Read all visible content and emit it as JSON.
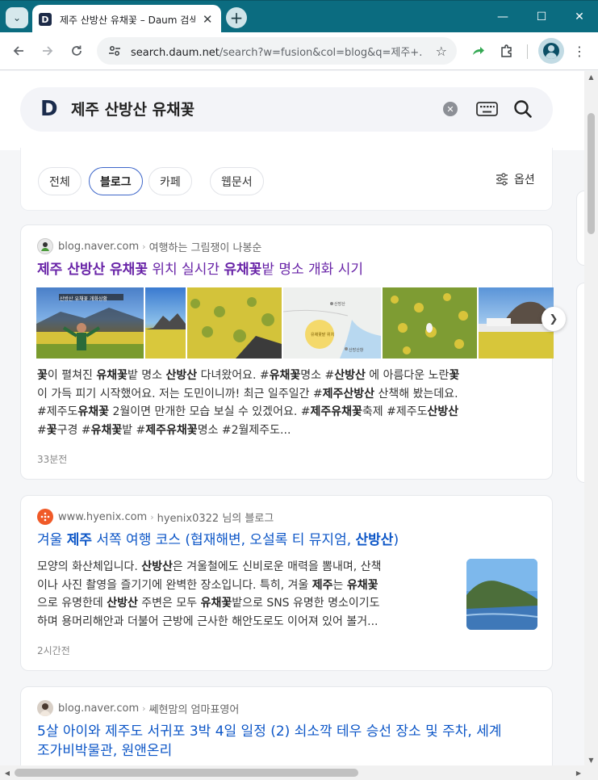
{
  "browser": {
    "tab_title": "제주 산방산 유채꽃 – Daum 검색",
    "favicon_letter": "D",
    "url_host": "search.daum.net",
    "url_rest": "/search?w=fusion&col=blog&q=제주+...",
    "icons": [
      "tab-list-icon",
      "close-icon",
      "new-tab-icon",
      "minimize-icon",
      "maximize-icon",
      "close-window-icon",
      "back-icon",
      "forward-icon",
      "reload-icon",
      "site-settings-icon",
      "bookmark-star-icon",
      "share-icon",
      "extensions-icon",
      "profile-icon",
      "more-menu-icon"
    ]
  },
  "search": {
    "logo": "D",
    "query": "제주 산방산 유채꽃"
  },
  "filters": {
    "chips": [
      "전체",
      "블로그",
      "카페",
      "웹문서"
    ],
    "active": "블로그",
    "options_label": "옵션"
  },
  "results": [
    {
      "source_host": "blog.naver.com",
      "source_author": "여행하는 그림쟁이 나봉순",
      "title_parts": [
        {
          "t": "제주 산방산 유채꽃",
          "b": true
        },
        {
          "t": " 위치 실시간 ",
          "b": false
        },
        {
          "t": "유채꽃",
          "b": true
        },
        {
          "t": "밭 명소 개화 시기",
          "b": false
        }
      ],
      "thumb_labels": [
        "산방산 유채꽃 개화상황",
        "유채꽃밭 위치",
        "산방산",
        "산방산항"
      ],
      "snippet_lines": [
        [
          {
            "t": "꽃",
            "b": true
          },
          {
            "t": "이 펼쳐진 ",
            "b": false
          },
          {
            "t": "유채꽃",
            "b": true
          },
          {
            "t": "밭 명소 ",
            "b": false
          },
          {
            "t": "산방산",
            "b": true
          },
          {
            "t": " 다녀왔어요.  #",
            "b": false
          },
          {
            "t": "유채꽃",
            "b": true
          },
          {
            "t": "명소 #",
            "b": false
          },
          {
            "t": "산방산",
            "b": true
          },
          {
            "t": " 에 아름다운 노란",
            "b": false
          },
          {
            "t": "꽃",
            "b": true
          }
        ],
        [
          {
            "t": "이 가득 피기 시작했어요. 저는 도민이니까! 최근 일주일간 #",
            "b": false
          },
          {
            "t": "제주산방산",
            "b": true
          },
          {
            "t": " 산책해 봤는데요.",
            "b": false
          }
        ],
        [
          {
            "t": "#제주도",
            "b": false
          },
          {
            "t": "유채꽃",
            "b": true
          },
          {
            "t": " 2월이면 만개한 모습 보실 수 있겠어요. #",
            "b": false
          },
          {
            "t": "제주유채꽃",
            "b": true
          },
          {
            "t": "축제 #제주도",
            "b": false
          },
          {
            "t": "산방산",
            "b": true
          }
        ],
        [
          {
            "t": "#",
            "b": false
          },
          {
            "t": "꽃",
            "b": true
          },
          {
            "t": "구경 #",
            "b": false
          },
          {
            "t": "유채꽃",
            "b": true
          },
          {
            "t": "밭 #",
            "b": false
          },
          {
            "t": "제주유채꽃",
            "b": true
          },
          {
            "t": "명소 #2월제주도...",
            "b": false
          }
        ]
      ],
      "time": "33분전"
    },
    {
      "source_host": "www.hyenix.com",
      "source_author": "hyenix0322 님의 블로그",
      "title_parts": [
        {
          "t": "겨울 ",
          "b": false
        },
        {
          "t": "제주",
          "b": true
        },
        {
          "t": " 서쪽 여행 코스 (협재해변, 오설록 티 뮤지엄, ",
          "b": false
        },
        {
          "t": "산방산",
          "b": true
        },
        {
          "t": ")",
          "b": false
        }
      ],
      "snippet_lines": [
        [
          {
            "t": "모양의 화산체입니다. ",
            "b": false
          },
          {
            "t": "산방산",
            "b": true
          },
          {
            "t": "은 겨울철에도 신비로운 매력을 뽐내며, 산책",
            "b": false
          }
        ],
        [
          {
            "t": "이나 사진 촬영을 즐기기에 완벽한 장소입니다. 특히, 겨울 ",
            "b": false
          },
          {
            "t": "제주",
            "b": true
          },
          {
            "t": "는 ",
            "b": false
          },
          {
            "t": "유채꽃",
            "b": true
          }
        ],
        [
          {
            "t": "으로 유명한데 ",
            "b": false
          },
          {
            "t": "산방산",
            "b": true
          },
          {
            "t": " 주변은 모두 ",
            "b": false
          },
          {
            "t": "유채꽃",
            "b": true
          },
          {
            "t": "밭으로 SNS 유명한 명소이기도",
            "b": false
          }
        ],
        [
          {
            "t": "하며 용머리해안과 더불어 근방에 근사한 해안도로도 이어져 있어 볼거...",
            "b": false
          }
        ]
      ],
      "time": "2시간전"
    },
    {
      "source_host": "blog.naver.com",
      "source_author": "쎄현맘의 엄마표영어",
      "title_lines": [
        "5살 아이와 제주도 서귀포 3박 4일 일정 (2) 쇠소깍 테우 승선 장소 및 주차, 세계",
        "조가비박물관, 원앤온리"
      ]
    }
  ]
}
